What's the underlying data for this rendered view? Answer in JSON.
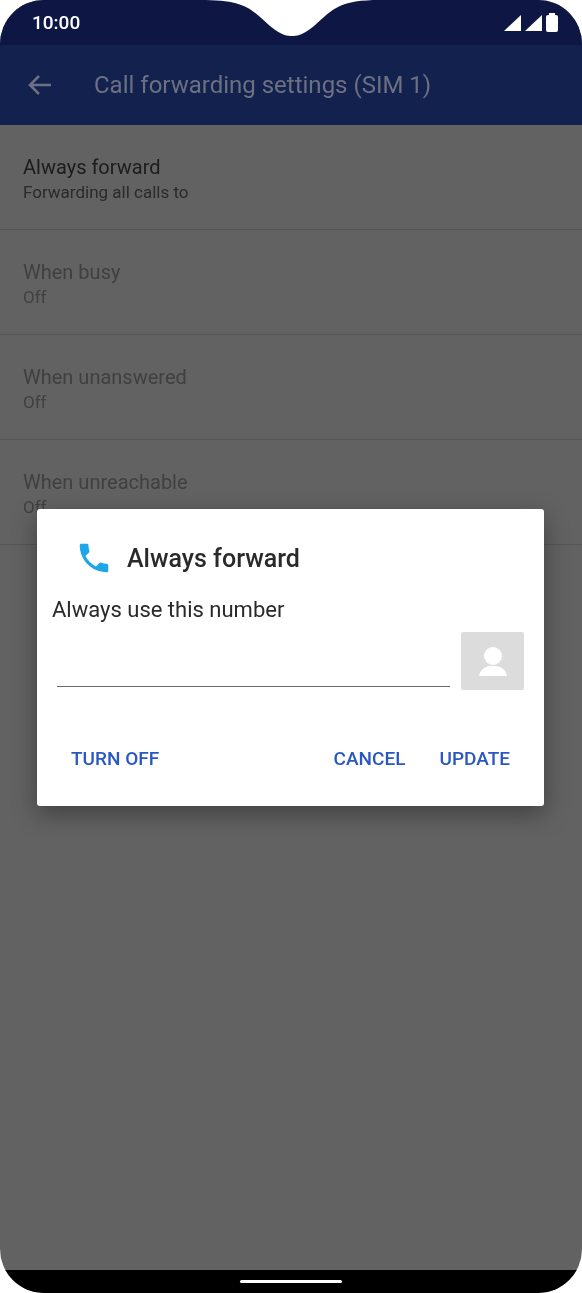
{
  "status_bar": {
    "time": "10:00"
  },
  "app_bar": {
    "title": "Call forwarding settings (SIM 1)"
  },
  "settings": [
    {
      "title": "Always forward",
      "summary": "Forwarding all calls to",
      "enabled": true
    },
    {
      "title": "When busy",
      "summary": "Off",
      "enabled": false
    },
    {
      "title": "When unanswered",
      "summary": "Off",
      "enabled": false
    },
    {
      "title": "When unreachable",
      "summary": "Off",
      "enabled": false
    }
  ],
  "dialog": {
    "title": "Always forward",
    "label": "Always use this number",
    "buttons": [
      {
        "label": "TURN OFF"
      },
      {
        "label": "CANCEL"
      },
      {
        "label": "UPDATE"
      }
    ]
  }
}
